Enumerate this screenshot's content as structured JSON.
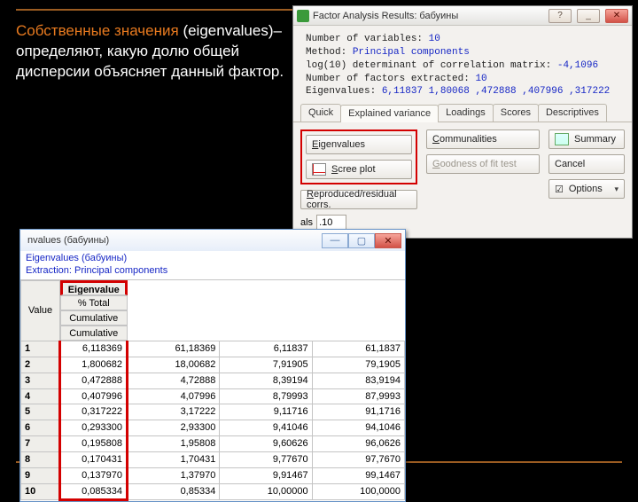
{
  "text": {
    "line1": "Собственные значения",
    "line2": "(eigenvalues)– определяют, какую долю общей дисперсии объясняет данный фактор."
  },
  "dialog": {
    "title": "Factor Analysis Results: бабуины",
    "info": {
      "l1a": "Number of variables: ",
      "l1b": "10",
      "l2a": "Method: ",
      "l2b": "Principal components",
      "l3a": "log(10) determinant of correlation matrix: ",
      "l3b": "-4,1096",
      "l4a": "Number of factors extracted: ",
      "l4b": "10",
      "l5a": "Eigenvalues: ",
      "l5b": "6,11837  1,80068  ,472888  ,407996  ,317222"
    },
    "tabs": [
      "Quick",
      "Explained variance",
      "Loadings",
      "Scores",
      "Descriptives"
    ],
    "buttons": {
      "eigen": "Eigenvalues",
      "scree": "Scree plot",
      "comm": "Communalities",
      "gof": "Goodness of fit test",
      "repro": "Reproduced/residual corrs.",
      "summary": "Summary",
      "cancel": "Cancel",
      "options": "Options"
    },
    "field": {
      "label": "als",
      "value": ".10"
    }
  },
  "grid": {
    "title": "nvalues (бабуины)",
    "hdr1": "Eigenvalues (бабуины)",
    "hdr2": "Extraction: Principal components",
    "cols": [
      "Value",
      "Eigenvalue",
      "% Total variance",
      "Cumulative Eigenvalue",
      "Cumulative %"
    ],
    "rows": [
      [
        "1",
        "6,118369",
        "61,18369",
        "6,11837",
        "61,1837"
      ],
      [
        "2",
        "1,800682",
        "18,00682",
        "7,91905",
        "79,1905"
      ],
      [
        "3",
        "0,472888",
        "4,72888",
        "8,39194",
        "83,9194"
      ],
      [
        "4",
        "0,407996",
        "4,07996",
        "8,79993",
        "87,9993"
      ],
      [
        "5",
        "0,317222",
        "3,17222",
        "9,11716",
        "91,1716"
      ],
      [
        "6",
        "0,293300",
        "2,93300",
        "9,41046",
        "94,1046"
      ],
      [
        "7",
        "0,195808",
        "1,95808",
        "9,60626",
        "96,0626"
      ],
      [
        "8",
        "0,170431",
        "1,70431",
        "9,77670",
        "97,7670"
      ],
      [
        "9",
        "0,137970",
        "1,37970",
        "9,91467",
        "99,1467"
      ],
      [
        "10",
        "0,085334",
        "0,85334",
        "10,00000",
        "100,0000"
      ]
    ]
  },
  "chart_data": {
    "type": "table",
    "title": "Eigenvalues (бабуины) — Extraction: Principal components",
    "columns": [
      "Value",
      "Eigenvalue",
      "% Total variance",
      "Cumulative Eigenvalue",
      "Cumulative %"
    ],
    "rows": [
      [
        1,
        6.118369,
        61.18369,
        6.11837,
        61.1837
      ],
      [
        2,
        1.800682,
        18.00682,
        7.91905,
        79.1905
      ],
      [
        3,
        0.472888,
        4.72888,
        8.39194,
        83.9194
      ],
      [
        4,
        0.407996,
        4.07996,
        8.79993,
        87.9993
      ],
      [
        5,
        0.317222,
        3.17222,
        9.11716,
        91.1716
      ],
      [
        6,
        0.2933,
        2.933,
        9.41046,
        94.1046
      ],
      [
        7,
        0.195808,
        1.95808,
        9.60626,
        96.0626
      ],
      [
        8,
        0.170431,
        1.70431,
        9.7767,
        97.767
      ],
      [
        9,
        0.13797,
        1.3797,
        9.91467,
        99.1467
      ],
      [
        10,
        0.085334,
        0.85334,
        10.0,
        100.0
      ]
    ]
  }
}
